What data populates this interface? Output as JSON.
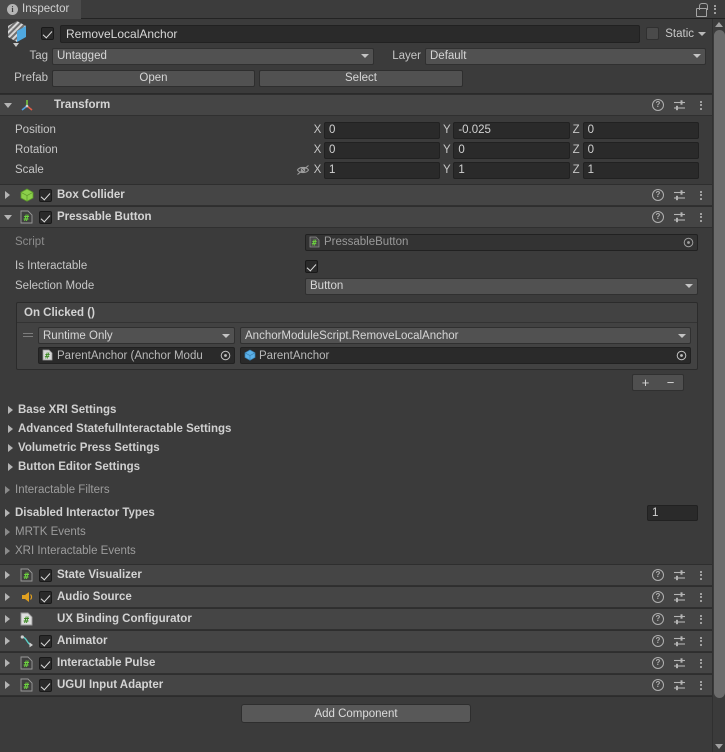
{
  "window": {
    "tab_label": "Inspector",
    "tab_icon": "info-icon",
    "lock_icon": "lock-icon",
    "menu_icon": "kebab-menu-icon"
  },
  "gameobject": {
    "prefab_icon": "prefab-cube-icon",
    "enabled": true,
    "name": "RemoveLocalAnchor",
    "static_label": "Static",
    "static_checked": false,
    "tag_label": "Tag",
    "tag_value": "Untagged",
    "layer_label": "Layer",
    "layer_value": "Default",
    "prefab_label": "Prefab",
    "prefab_open": "Open",
    "prefab_select": "Select"
  },
  "transform": {
    "title": "Transform",
    "icon": "transform-axis-icon",
    "rows": [
      {
        "label": "Position",
        "x": "0",
        "y": "-0.025",
        "z": "0",
        "eye": false
      },
      {
        "label": "Rotation",
        "x": "0",
        "y": "0",
        "z": "0",
        "eye": false
      },
      {
        "label": "Scale",
        "x": "1",
        "y": "1",
        "z": "1",
        "eye": true
      }
    ],
    "axis_x": "X",
    "axis_y": "Y",
    "axis_z": "Z"
  },
  "box_collider": {
    "title": "Box Collider",
    "icon": "box-collider-icon",
    "enabled": true
  },
  "pressable_button": {
    "title": "Pressable Button",
    "icon": "cs-script-icon",
    "enabled": true,
    "script_label": "Script",
    "script_value": "PressableButton",
    "is_interactable_label": "Is Interactable",
    "is_interactable_checked": true,
    "selection_mode_label": "Selection Mode",
    "selection_mode_value": "Button",
    "on_clicked": {
      "title": "On Clicked ()",
      "call_mode": "Runtime Only",
      "method": "AnchorModuleScript.RemoveLocalAnchor",
      "target_object": "ParentAnchor (Anchor Modu",
      "argument_object": "ParentAnchor",
      "add_label": "+",
      "remove_label": "−"
    },
    "foldouts": [
      {
        "label": "Base XRI Settings",
        "dim": false,
        "indent": true
      },
      {
        "label": "Advanced StatefulInteractable Settings",
        "dim": false,
        "indent": true
      },
      {
        "label": "Volumetric Press Settings",
        "dim": false,
        "indent": true
      },
      {
        "label": "Button Editor Settings",
        "dim": false,
        "indent": true
      },
      {
        "label": "Interactable Filters",
        "dim": true,
        "indent": false
      },
      {
        "label": "Disabled Interactor Types",
        "dim": false,
        "indent": false,
        "count": "1"
      },
      {
        "label": "MRTK Events",
        "dim": true,
        "indent": false
      },
      {
        "label": "XRI Interactable Events",
        "dim": true,
        "indent": false
      }
    ]
  },
  "components": [
    {
      "title": "State Visualizer",
      "icon": "cs-script-icon",
      "has_checkbox": true,
      "enabled": true
    },
    {
      "title": "Audio Source",
      "icon": "audio-source-icon",
      "has_checkbox": true,
      "enabled": true
    },
    {
      "title": "UX Binding Configurator",
      "icon": "cs-script-grey-icon",
      "has_checkbox": false,
      "enabled": false
    },
    {
      "title": "Animator",
      "icon": "animator-icon",
      "has_checkbox": true,
      "enabled": true
    },
    {
      "title": "Interactable Pulse",
      "icon": "cs-script-icon",
      "has_checkbox": true,
      "enabled": true
    },
    {
      "title": "UGUI Input Adapter",
      "icon": "cs-script-icon",
      "has_checkbox": true,
      "enabled": true
    }
  ],
  "component_tools": {
    "help_icon": "help-icon",
    "help_glyph": "?",
    "preset_icon": "preset-settings-icon",
    "menu_icon": "kebab-menu-icon"
  },
  "footer": {
    "add_component": "Add Component"
  },
  "colors": {
    "background": "#3b3b3b",
    "header": "#454545",
    "field": "#2a2a2a",
    "accent_green": "#8ccf4b",
    "accent_blue": "#5bb0e8",
    "accent_orange": "#e0a020",
    "accent_teal": "#5ad0c8"
  }
}
